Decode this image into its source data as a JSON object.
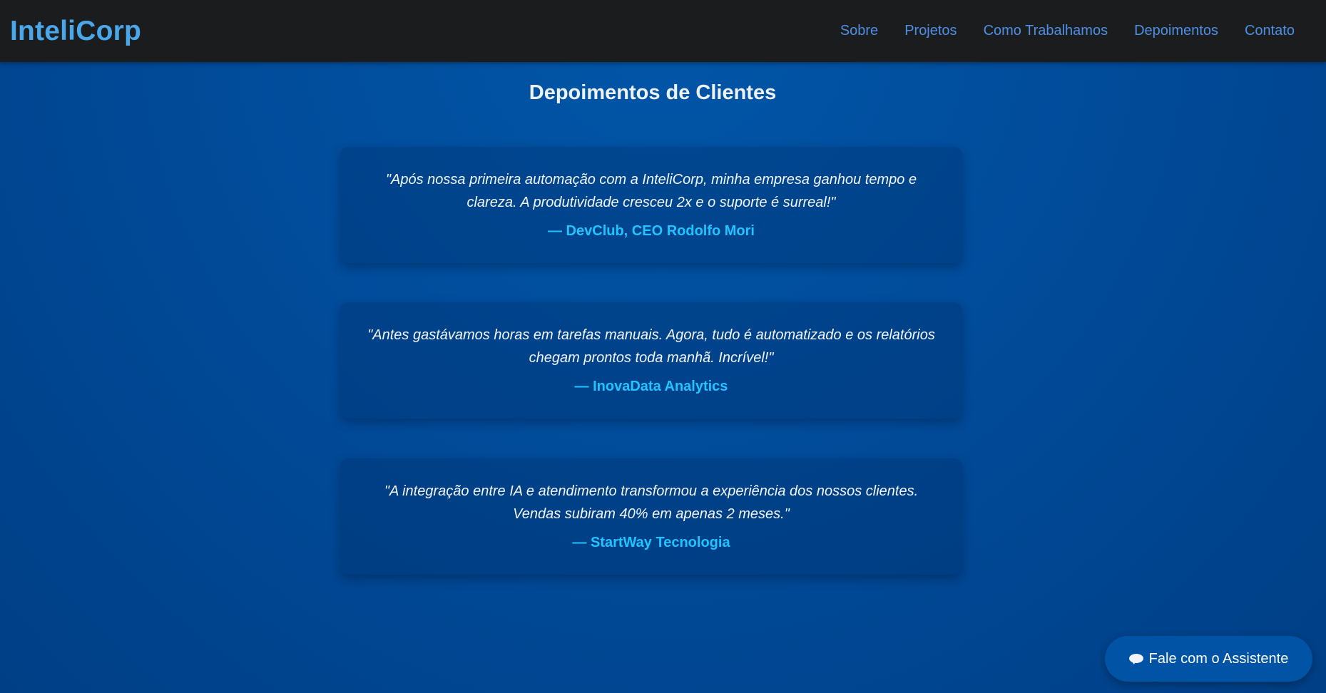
{
  "header": {
    "logo": "InteliCorp",
    "nav": [
      {
        "label": "Sobre"
      },
      {
        "label": "Projetos"
      },
      {
        "label": "Como Trabalhamos"
      },
      {
        "label": "Depoimentos"
      },
      {
        "label": "Contato"
      }
    ]
  },
  "testimonials": {
    "title": "Depoimentos de Clientes",
    "items": [
      {
        "quote": "\"Após nossa primeira automação com a InteliCorp, minha empresa ganhou tempo e clareza. A produtividade cresceu 2x e o suporte é surreal!\"",
        "author": "— DevClub, CEO Rodolfo Mori"
      },
      {
        "quote": "\"Antes gastávamos horas em tarefas manuais. Agora, tudo é automatizado e os relatórios chegam prontos toda manhã. Incrível!\"",
        "author": "— InovaData Analytics"
      },
      {
        "quote": "\"A integração entre IA e atendimento transformou a experiência dos nossos clientes. Vendas subiram 40% em apenas 2 meses.\"",
        "author": "— StartWay Tecnologia"
      }
    ]
  },
  "chat": {
    "label": "Fale com o Assistente",
    "icon": "chat-bubble-icon"
  },
  "colors": {
    "background": "#014c9b",
    "topbar": "#1b1c1e",
    "logo": "#4aa7ea",
    "nav_link": "#4e8fe4",
    "author": "#21c4ff",
    "chat_button": "#0153a5"
  }
}
